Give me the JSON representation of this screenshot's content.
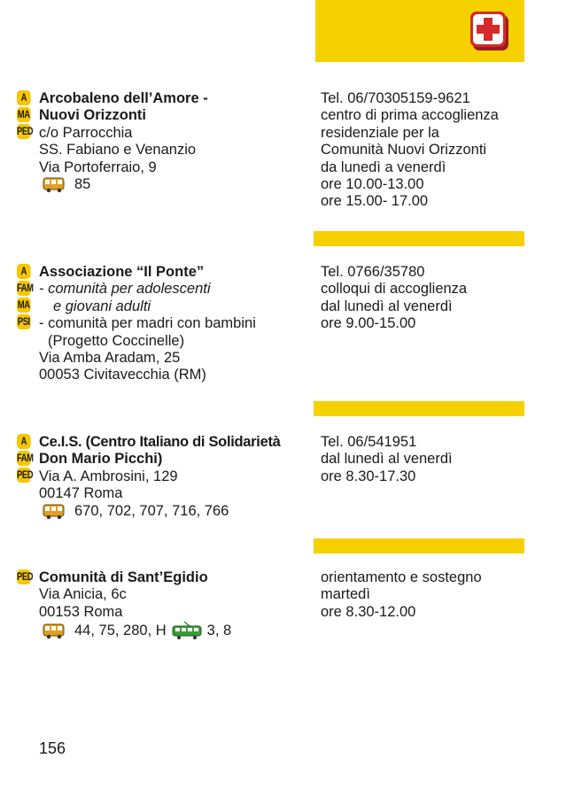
{
  "page_number": "156",
  "header_icon": "first-aid-cross-icon",
  "entries": [
    {
      "badges": [
        "A",
        "MA",
        "PED"
      ],
      "title_lines": [
        "Arcobaleno dell’Amore -",
        "Nuovi Orizzonti"
      ],
      "address_lines": [
        "c/o  Parrocchia",
        "SS. Fabiano e Venanzio",
        "Via Portoferraio, 9"
      ],
      "bus": "85",
      "info_lines": [
        "Tel. 06/70305159-9621",
        "centro di prima accoglienza",
        "residenziale per la",
        "Comunità Nuovi Orizzonti",
        "da lunedì a venerdì",
        "ore 10.00-13.00",
        "ore 15.00- 17.00"
      ]
    },
    {
      "badges": [
        "A",
        "FAM",
        "MA",
        "PSI"
      ],
      "title_lines": [
        "Associazione “Il Ponte”"
      ],
      "italic_lines": [
        "- comunità per adolescenti",
        "e giovani adulti"
      ],
      "address_lines": [
        "- comunità per madri con bambini",
        "(Progetto Coccinelle)",
        "Via Amba Aradam, 25",
        "00053 Civitavecchia (RM)"
      ],
      "info_lines": [
        "Tel. 0766/35780",
        "colloqui di accoglienza",
        "dal lunedì al venerdì",
        "ore 9.00-15.00"
      ]
    },
    {
      "badges": [
        "A",
        "FAM",
        "PED"
      ],
      "title_lines": [
        "Ce.I.S. (Centro Italiano di Solidarietà",
        "Don Mario Picchi)"
      ],
      "address_lines": [
        "Via A. Ambrosini, 129",
        "00147 Roma"
      ],
      "bus": "670, 702, 707, 716, 766",
      "info_lines": [
        "Tel. 06/541951",
        "dal lunedì al venerdì",
        "ore 8.30-17.30"
      ]
    },
    {
      "badges": [
        "PED"
      ],
      "title_lines": [
        "Comunità di Sant’Egidio"
      ],
      "address_lines": [
        "Via Anicia, 6c",
        "00153 Roma"
      ],
      "bus": "44, 75, 280, H",
      "tram": "3, 8",
      "info_lines": [
        "orientamento e sostegno",
        "martedì",
        "ore 8.30-12.00"
      ]
    }
  ],
  "colors": {
    "accent_yellow": "#f7d000",
    "badge_yellow": "#f7c600",
    "cross_red": "#d42a2a",
    "tram_green": "#3c9a3c"
  }
}
